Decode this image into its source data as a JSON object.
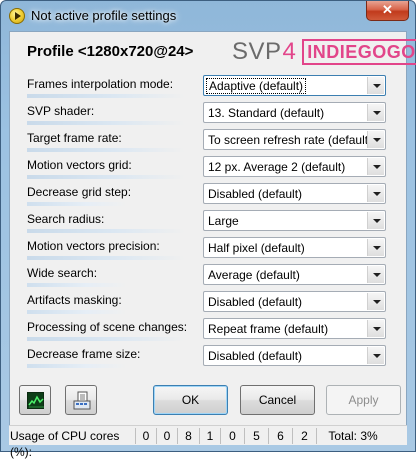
{
  "window": {
    "title": "Not active profile settings",
    "close_glyph": "✕"
  },
  "profile": {
    "title": "Profile <1280x720@24>"
  },
  "logo": {
    "svp": "SVP",
    "version": "4",
    "badge": "INDIEGOGO",
    "accent_color": "#e2458a"
  },
  "settings": [
    {
      "label": "Frames interpolation mode:",
      "value": "Adaptive (default)"
    },
    {
      "label": "SVP shader:",
      "value": "13. Standard (default)"
    },
    {
      "label": "Target frame rate:",
      "value": "To screen refresh rate (default)"
    },
    {
      "label": "Motion vectors grid:",
      "value": "12 px. Average 2 (default)"
    },
    {
      "label": "Decrease grid step:",
      "value": "Disabled (default)"
    },
    {
      "label": "Search radius:",
      "value": "Large"
    },
    {
      "label": "Motion vectors precision:",
      "value": "Half pixel (default)"
    },
    {
      "label": "Wide search:",
      "value": "Average (default)"
    },
    {
      "label": "Artifacts masking:",
      "value": "Disabled (default)"
    },
    {
      "label": "Processing of scene changes:",
      "value": "Repeat frame (default)"
    },
    {
      "label": "Decrease frame size:",
      "value": "Disabled (default)"
    }
  ],
  "buttons": {
    "ok": "OK",
    "cancel": "Cancel",
    "apply": "Apply",
    "graph_icon": "graph-monitor-icon",
    "compat_icon": "compatibility-icon"
  },
  "status": {
    "label": "Usage of CPU cores (%):",
    "cores": [
      "0",
      "0",
      "8",
      "1",
      "0",
      "5",
      "6",
      "2"
    ],
    "total": "Total: 3%"
  }
}
